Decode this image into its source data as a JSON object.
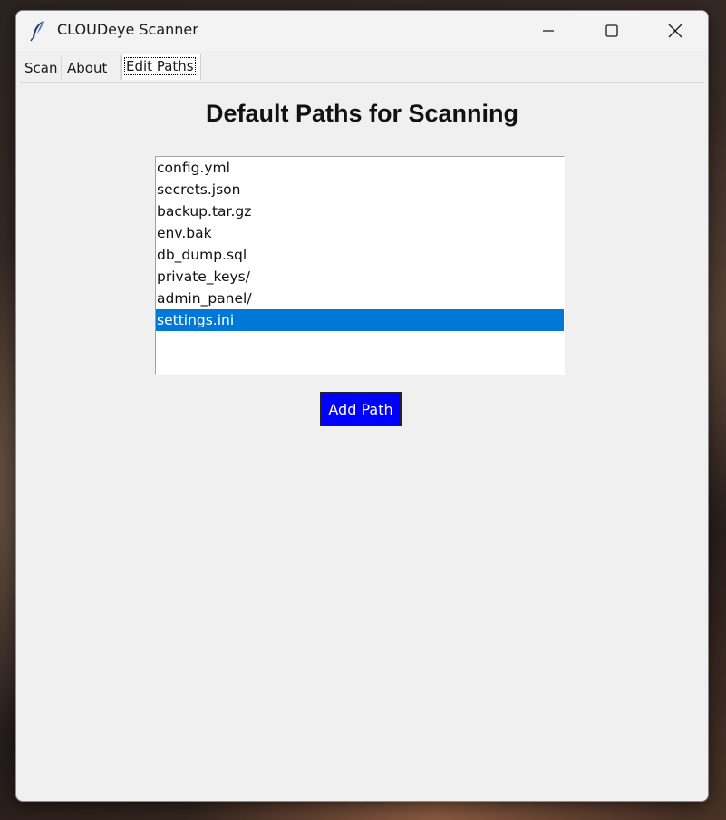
{
  "window": {
    "title": "CLOUDeye Scanner",
    "icon": "feather-icon"
  },
  "tabs": [
    {
      "label": "Scan",
      "active": false
    },
    {
      "label": "About",
      "active": false
    },
    {
      "label": "Edit Paths",
      "active": true
    }
  ],
  "main": {
    "heading": "Default Paths for Scanning",
    "paths": [
      "config.yml",
      "secrets.json",
      "backup.tar.gz",
      "env.bak",
      "db_dump.sql",
      "private_keys/",
      "admin_panel/",
      "settings.ini"
    ],
    "selected_path": "settings.ini",
    "add_button_label": "Add Path"
  },
  "colors": {
    "selection": "#0078d7",
    "add_button": "#0000ff",
    "window_bg": "#f0f0f0"
  }
}
